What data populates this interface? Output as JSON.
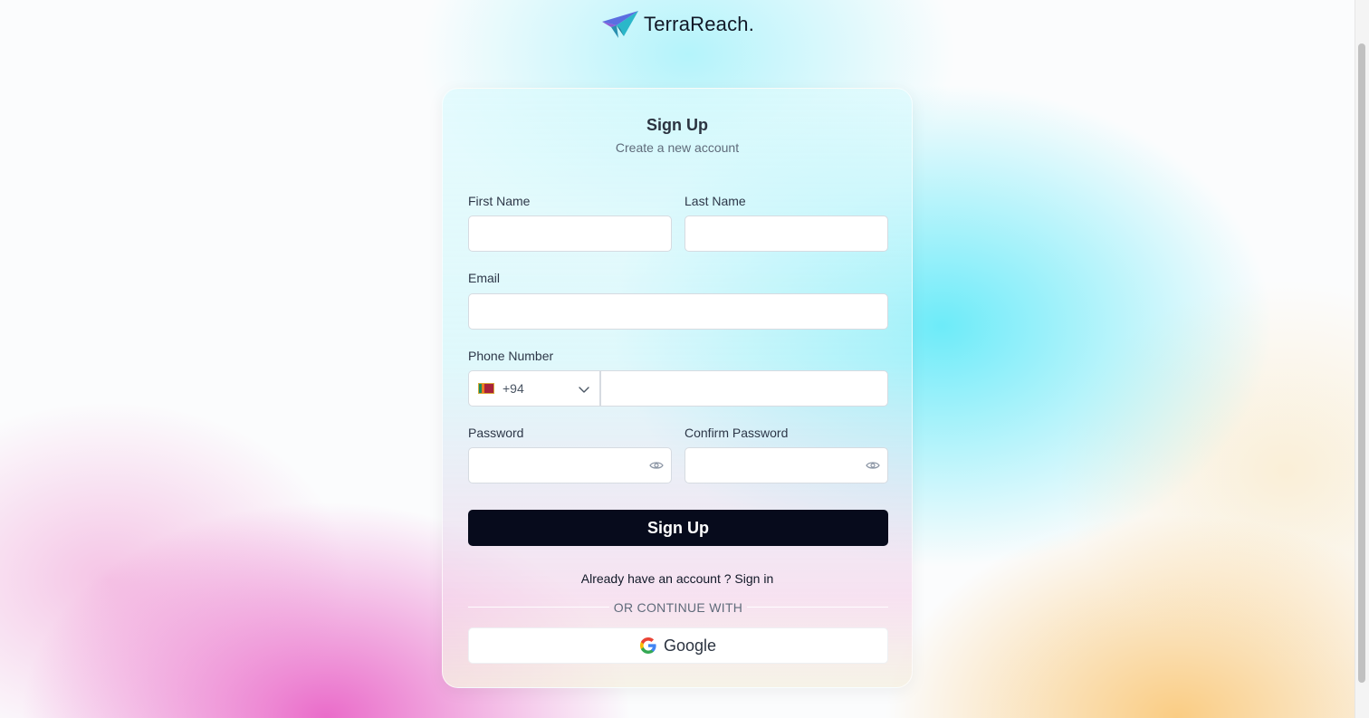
{
  "brand": {
    "name": "TerraReach."
  },
  "form": {
    "title": "Sign Up",
    "subtitle": "Create a new account",
    "first_name": {
      "label": "First Name",
      "value": ""
    },
    "last_name": {
      "label": "Last Name",
      "value": ""
    },
    "email": {
      "label": "Email",
      "value": ""
    },
    "phone": {
      "label": "Phone Number",
      "dial_code": "+94",
      "value": ""
    },
    "password": {
      "label": "Password",
      "value": ""
    },
    "confirm_password": {
      "label": "Confirm Password",
      "value": ""
    },
    "submit_label": "Sign Up",
    "already_text": "Already have an account ?",
    "signin_label": "Sign in",
    "divider_text": "OR CONTINUE WITH",
    "google_label": "Google"
  },
  "colors": {
    "primary_button": "#070b1c",
    "accent_cyan": "#54e8f8",
    "accent_pink": "#e85cc4",
    "accent_orange": "#fac46e"
  },
  "icons": {
    "logo": "paper-plane-icon",
    "password_toggle": "eye-icon",
    "country_dropdown": "chevron-down-icon",
    "country_flag": "sri-lanka-flag-icon",
    "social": "google-icon"
  }
}
